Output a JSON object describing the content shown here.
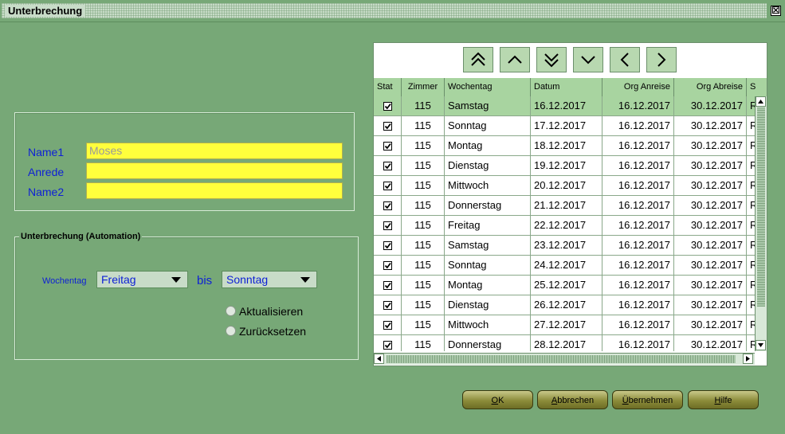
{
  "window": {
    "title": "Unterbrechung",
    "close_glyph": "☒"
  },
  "name_group": {
    "name1_label": "Name1",
    "name1_value": "Moses",
    "anrede_label": "Anrede",
    "anrede_value": "",
    "name2_label": "Name2",
    "name2_value": ""
  },
  "automation": {
    "legend": "Unterbrechung (Automation)",
    "wochentag_label": "Wochentag",
    "from_value": "Freitag",
    "bis_label": "bis",
    "to_value": "Sonntag",
    "radio_update": "Aktualisieren",
    "radio_reset": "Zurücksetzen"
  },
  "nav_icons": [
    "first-icon",
    "previous-icon",
    "last-icon",
    "next-icon",
    "left-icon",
    "right-icon"
  ],
  "table": {
    "columns": [
      "Stat",
      "Zimmer",
      "Wochentag",
      "Datum",
      "Org Anreise",
      "Org Abreise",
      "S"
    ],
    "rows": [
      {
        "zimmer": "115",
        "wochentag": "Samstag",
        "datum": "16.12.2017",
        "anreise": "16.12.2017",
        "abreise": "30.12.2017",
        "s": "R"
      },
      {
        "zimmer": "115",
        "wochentag": "Sonntag",
        "datum": "17.12.2017",
        "anreise": "16.12.2017",
        "abreise": "30.12.2017",
        "s": "R"
      },
      {
        "zimmer": "115",
        "wochentag": "Montag",
        "datum": "18.12.2017",
        "anreise": "16.12.2017",
        "abreise": "30.12.2017",
        "s": "R"
      },
      {
        "zimmer": "115",
        "wochentag": "Dienstag",
        "datum": "19.12.2017",
        "anreise": "16.12.2017",
        "abreise": "30.12.2017",
        "s": "R"
      },
      {
        "zimmer": "115",
        "wochentag": "Mittwoch",
        "datum": "20.12.2017",
        "anreise": "16.12.2017",
        "abreise": "30.12.2017",
        "s": "R"
      },
      {
        "zimmer": "115",
        "wochentag": "Donnerstag",
        "datum": "21.12.2017",
        "anreise": "16.12.2017",
        "abreise": "30.12.2017",
        "s": "R"
      },
      {
        "zimmer": "115",
        "wochentag": "Freitag",
        "datum": "22.12.2017",
        "anreise": "16.12.2017",
        "abreise": "30.12.2017",
        "s": "R"
      },
      {
        "zimmer": "115",
        "wochentag": "Samstag",
        "datum": "23.12.2017",
        "anreise": "16.12.2017",
        "abreise": "30.12.2017",
        "s": "R"
      },
      {
        "zimmer": "115",
        "wochentag": "Sonntag",
        "datum": "24.12.2017",
        "anreise": "16.12.2017",
        "abreise": "30.12.2017",
        "s": "R"
      },
      {
        "zimmer": "115",
        "wochentag": "Montag",
        "datum": "25.12.2017",
        "anreise": "16.12.2017",
        "abreise": "30.12.2017",
        "s": "R"
      },
      {
        "zimmer": "115",
        "wochentag": "Dienstag",
        "datum": "26.12.2017",
        "anreise": "16.12.2017",
        "abreise": "30.12.2017",
        "s": "R"
      },
      {
        "zimmer": "115",
        "wochentag": "Mittwoch",
        "datum": "27.12.2017",
        "anreise": "16.12.2017",
        "abreise": "30.12.2017",
        "s": "R"
      },
      {
        "zimmer": "115",
        "wochentag": "Donnerstag",
        "datum": "28.12.2017",
        "anreise": "16.12.2017",
        "abreise": "30.12.2017",
        "s": "R"
      }
    ]
  },
  "buttons": {
    "ok": {
      "u": "O",
      "rest": "K"
    },
    "abbrechen": {
      "u": "A",
      "rest": "bbrechen"
    },
    "uebernehmen": {
      "u": "Ü",
      "rest": "bernehmen"
    },
    "hilfe": {
      "u": "H",
      "rest": "ilfe"
    }
  }
}
